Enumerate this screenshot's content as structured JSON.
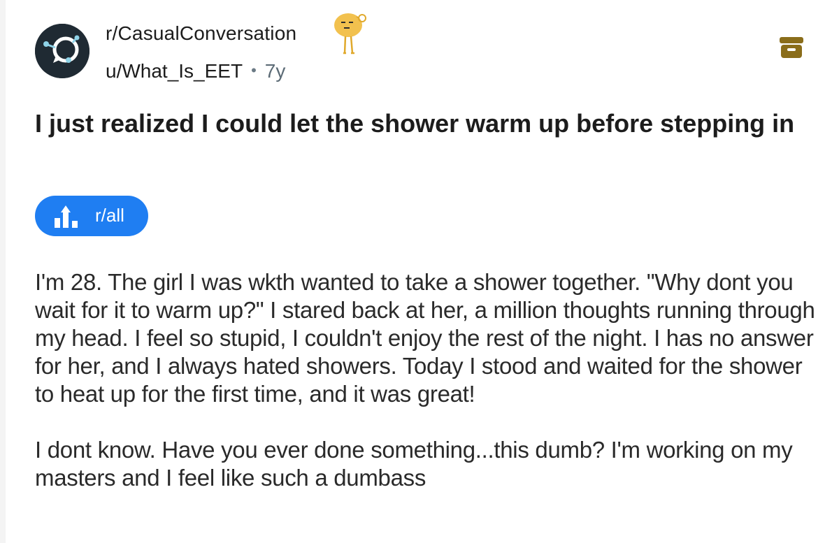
{
  "post": {
    "subreddit": "r/CasualConversation",
    "author": "u/What_Is_EET",
    "separator": "•",
    "age": "7y",
    "title": "I just realized I could let the shower warm up before stepping in",
    "flair": {
      "label": "r/all",
      "icon": "trending-up-icon",
      "color": "#1f7ef2"
    },
    "body_paragraphs": [
      "I'm 28. The girl I was wkth wanted to take a shower together. \"Why dont you wait for it to warm up?\" I stared back at her, a million thoughts running through my head. I feel so stupid, I couldn't enjoy the rest of the night. I has no answer for her, and I always hated showers. Today I stood and waited for the shower to heat up for the first time, and it was great!",
      "I dont know. Have you ever done something...this dumb? I'm working on my masters and I feel like such a dumbass"
    ]
  },
  "icons": {
    "avatar": "subreddit-avatar-icon",
    "mascot": "snoo-mascot-icon",
    "archive": "archive-icon",
    "archive_color": "#8a6d1a"
  }
}
